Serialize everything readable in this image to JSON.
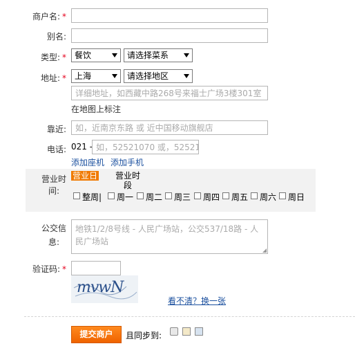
{
  "form": {
    "merchant_name": {
      "label": "商户名:",
      "required_mark": "*",
      "value": ""
    },
    "alias": {
      "label": "别名:",
      "value": ""
    },
    "type": {
      "label": "类型:",
      "required_mark": "*",
      "select1": "餐饮",
      "select2": "请选择菜系"
    },
    "address": {
      "label": "地址:",
      "required_mark": "*",
      "city": "上海",
      "district": "请选择地区",
      "detail_placeholder": "详细地址，如西藏中路268号来福士广场3楼301室",
      "map_link": "在地图上标注"
    },
    "nearby": {
      "label": "靠近:",
      "placeholder": "如，近南京东路 或 近中国移动旗舰店"
    },
    "phone": {
      "label": "电话:",
      "prefix": "021 -",
      "placeholder": "如，52521070 或，52521070",
      "add_landline": "添加座机",
      "add_mobile": "添加手机"
    },
    "hours": {
      "label_line1": "营业时",
      "label_line2": "间:",
      "tab_weekday": "营业日",
      "tab_hours_line1": "营业时",
      "tab_hours_line2": "段",
      "days": [
        "整周|",
        "周一",
        "周二",
        "周三",
        "周四",
        "周五",
        "周六",
        "周日"
      ]
    },
    "bus": {
      "label_line1": "公交信",
      "label_line2": "息:",
      "placeholder": "地铁1/2/8号线 - 人民广场站，公交537/18路 - 人民广场站"
    },
    "captcha": {
      "label": "验证码:",
      "required_mark": "*",
      "value": "",
      "image_text": "mvwN",
      "refresh_link": "看不清？换一张"
    }
  },
  "footer": {
    "submit_label": "提交商户",
    "sync_label": "且同步到:"
  },
  "colors": {
    "accent": "#f07a00",
    "required": "#e5001c",
    "link": "#1a4f9e"
  }
}
